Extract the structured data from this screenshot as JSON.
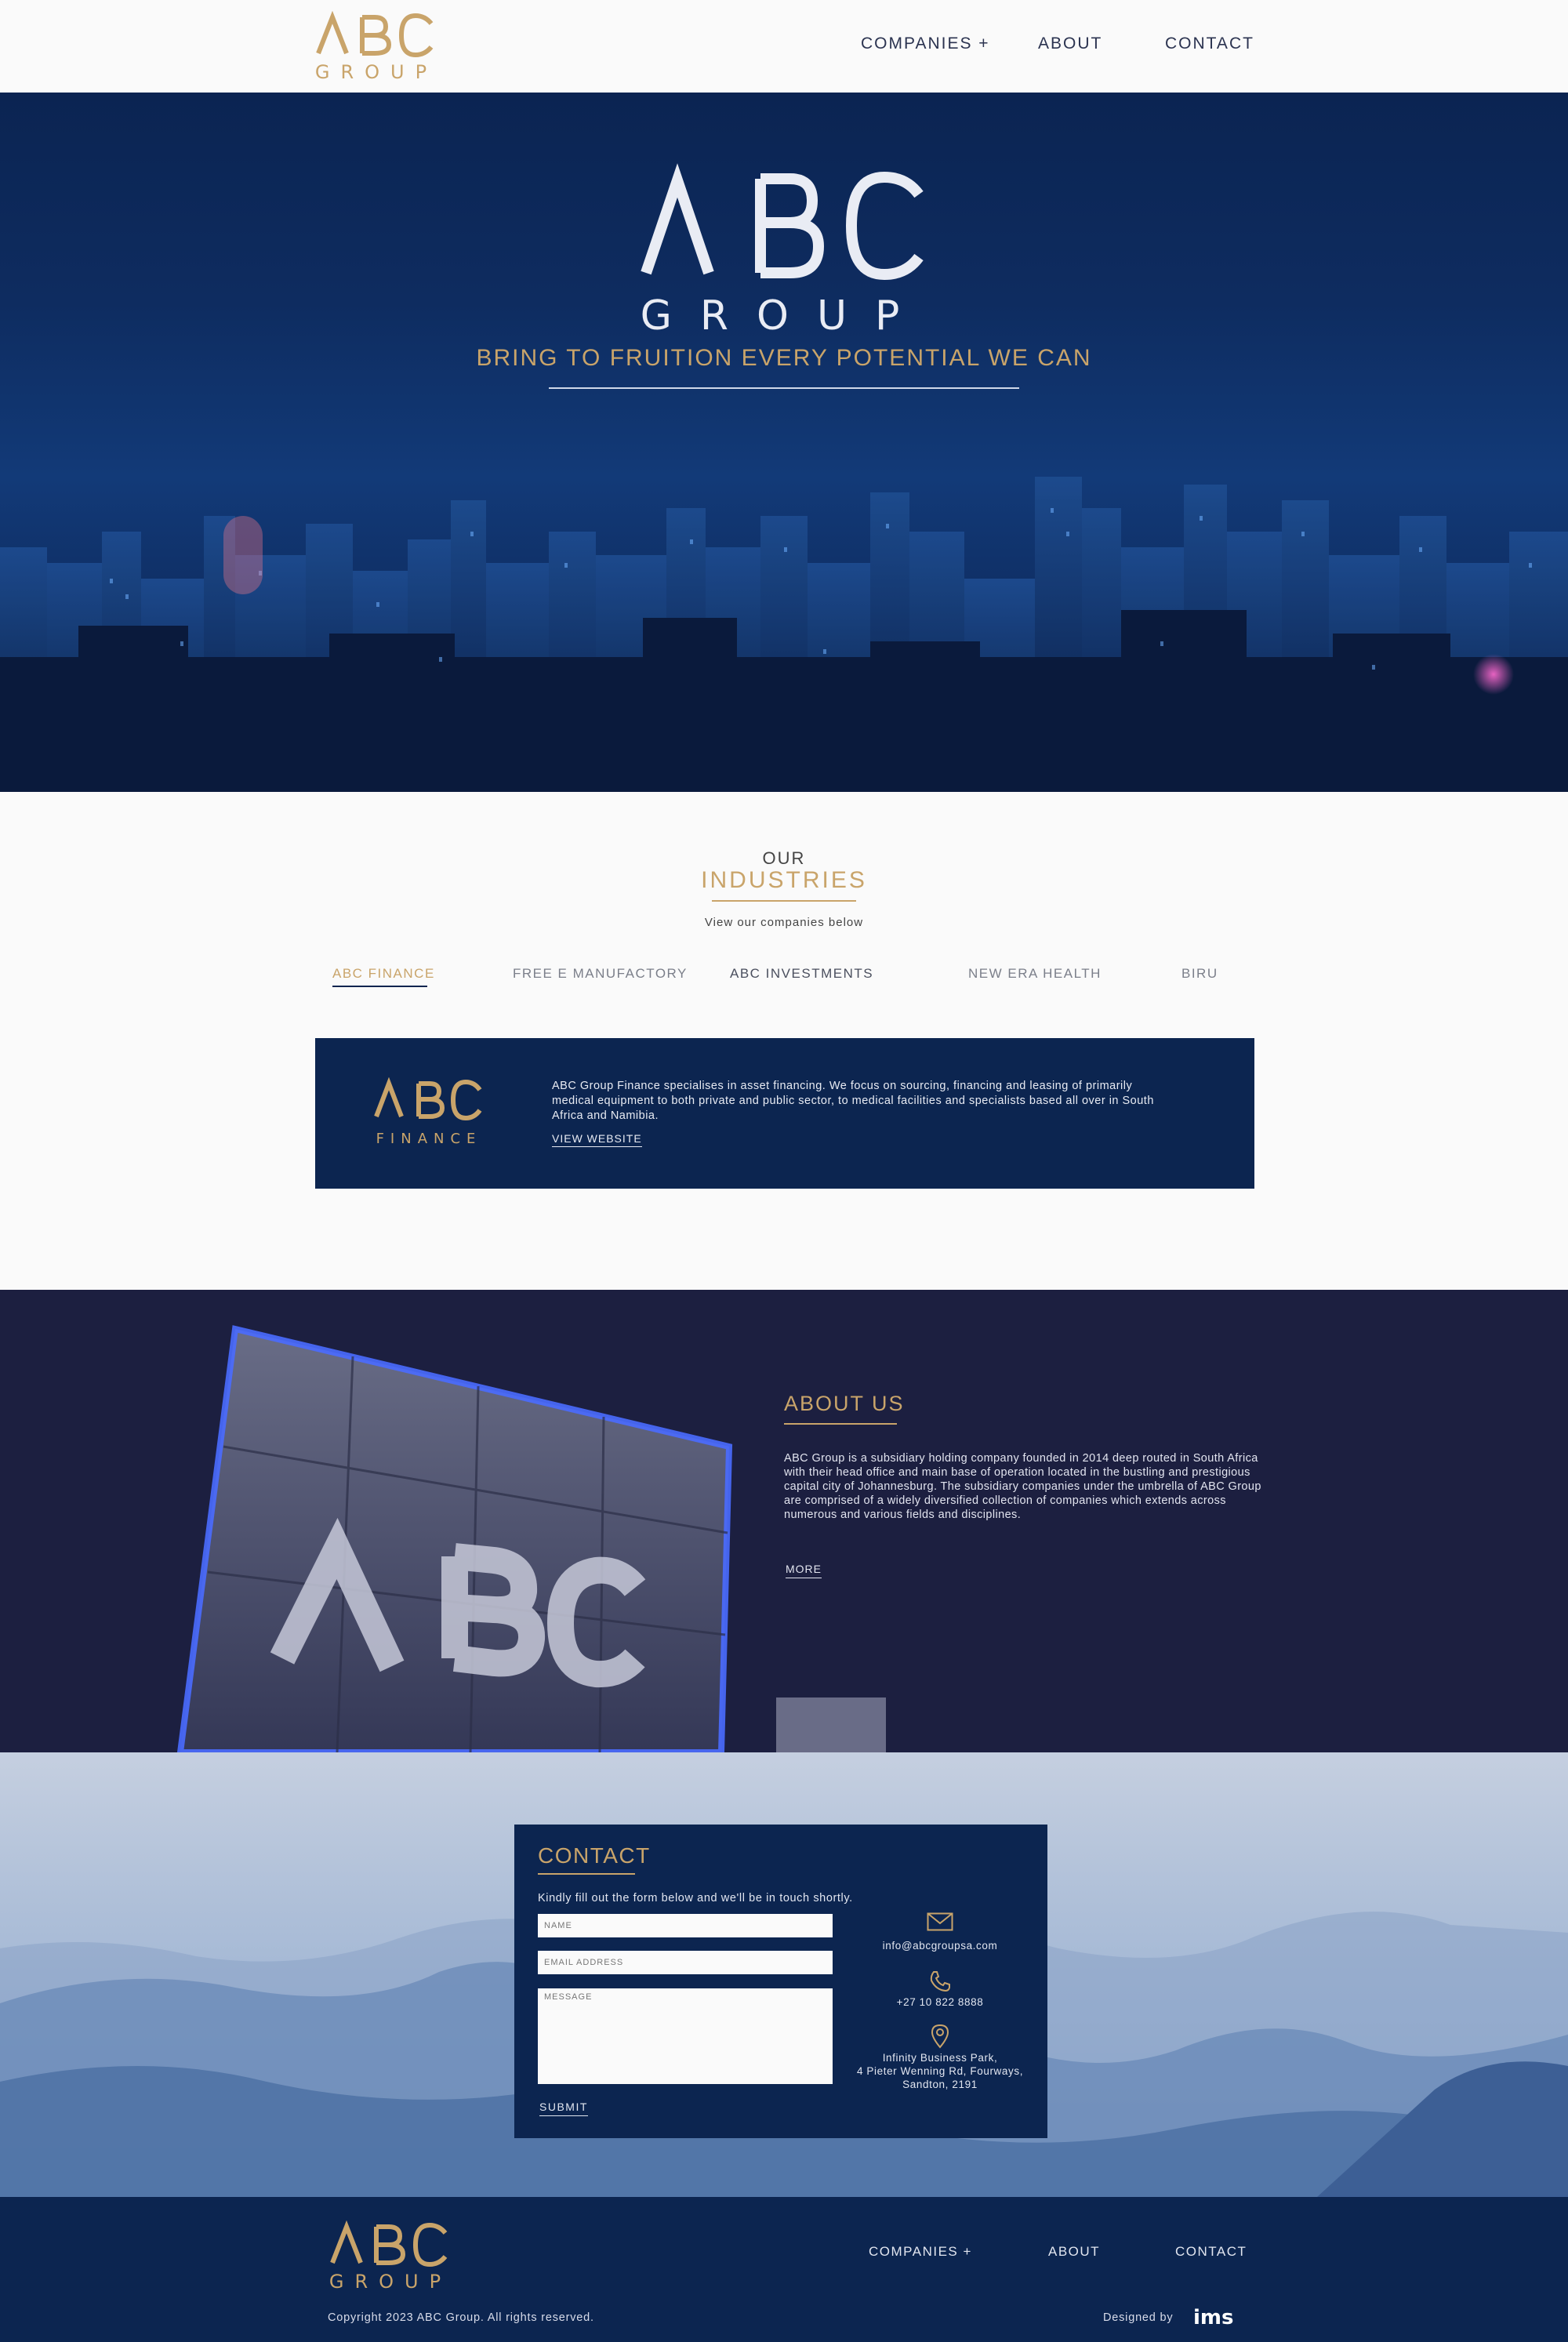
{
  "brand": {
    "logo_top": "ABC",
    "logo_bottom": "GROUP",
    "gold": "#c9a46a",
    "navy": "#0c2550"
  },
  "nav": {
    "companies": "COMPANIES +",
    "about": "ABOUT",
    "contact": "CONTACT"
  },
  "hero": {
    "tagline": "BRING TO FRUITION EVERY POTENTIAL WE CAN"
  },
  "industries": {
    "eyebrow": "OUR",
    "title": "INDUSTRIES",
    "subtitle": "View our companies below",
    "tabs": [
      {
        "label": "ABC FINANCE",
        "active": true
      },
      {
        "label": "FREE E MANUFACTORY",
        "active": false
      },
      {
        "label": "ABC INVESTMENTS",
        "active": false
      },
      {
        "label": "NEW ERA HEALTH",
        "active": false
      },
      {
        "label": "BIRU",
        "active": false
      }
    ],
    "card": {
      "logo_top": "ABC",
      "logo_bottom": "FINANCE",
      "description": "ABC Group Finance specialises in asset financing. We focus on sourcing, financing and leasing of primarily medical equipment to both private and public sector, to medical facilities and specialists based all over in South Africa and Namibia.",
      "link": "VIEW WEBSITE"
    }
  },
  "about": {
    "title": "ABOUT US",
    "text": "ABC Group is a subsidiary holding company founded in 2014 deep routed in South Africa with their head office and main base of operation located in the bustling and prestigious capital city of Johannesburg. The subsidiary companies under the umbrella of ABC Group are comprised of a widely diversified collection of companies which extends across numerous and various fields and disciplines.",
    "more": "MORE"
  },
  "contact": {
    "title": "CONTACT",
    "intro": "Kindly fill out the form below and we'll be in touch shortly.",
    "name_placeholder": "NAME",
    "email_placeholder": "EMAIL ADDRESS",
    "message_placeholder": "MESSAGE",
    "submit": "SUBMIT",
    "email": "info@abcgroupsa.com",
    "phone": "+27 10 822 8888",
    "address_line1": "Infinity Business Park,",
    "address_line2": "4 Pieter Wenning Rd, Fourways,",
    "address_line3": "Sandton, 2191"
  },
  "footer": {
    "copyright": "Copyright 2023 ABC Group. All rights reserved.",
    "designed_by": "Designed by",
    "designer_logo": "ims"
  },
  "icons": {
    "email": "envelope-icon",
    "phone": "phone-icon",
    "address": "map-pin-icon"
  }
}
